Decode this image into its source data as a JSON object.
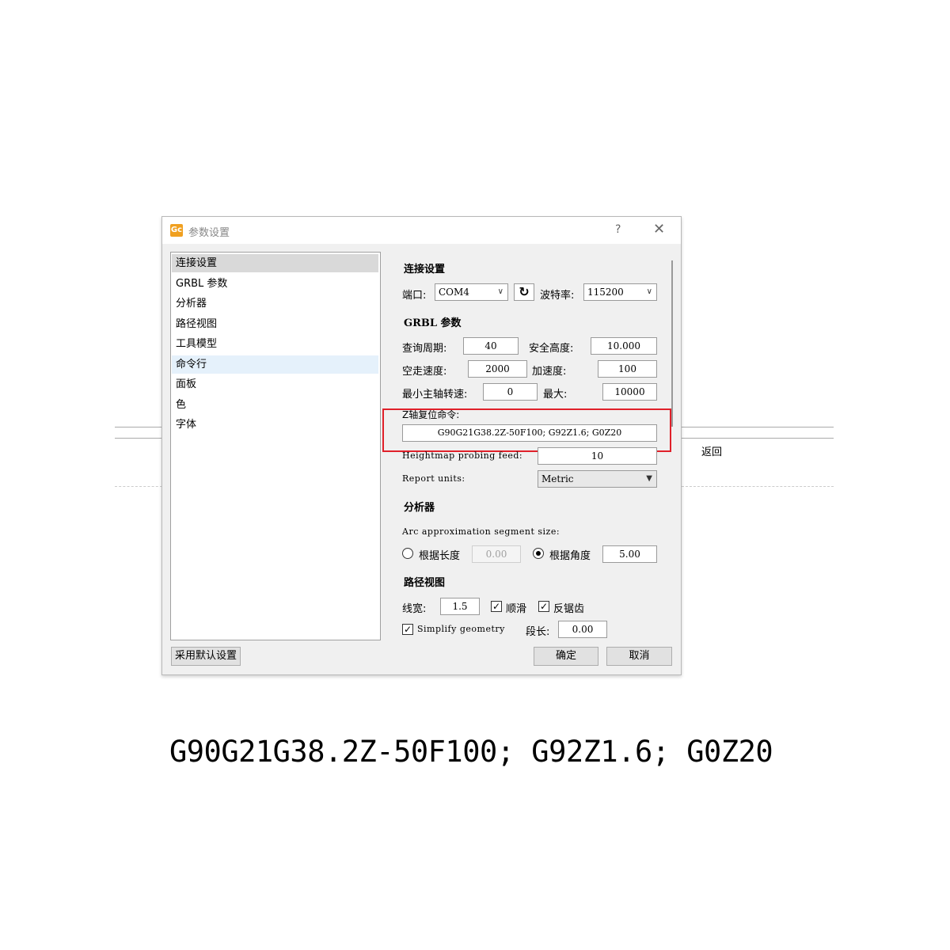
{
  "background": {
    "back_label": "返回"
  },
  "dialog": {
    "title": "参数设置",
    "help_glyph": "?",
    "close_glyph": "✕",
    "icon_letter": "Gc"
  },
  "nav": {
    "items": [
      {
        "label": "连接设置"
      },
      {
        "label": "GRBL 参数"
      },
      {
        "label": "分析器"
      },
      {
        "label": "路径视图"
      },
      {
        "label": "工具模型"
      },
      {
        "label": "命令行"
      },
      {
        "label": "面板"
      },
      {
        "label": "色"
      },
      {
        "label": "字体"
      }
    ],
    "selected_index": 0,
    "hovered_index": 5
  },
  "connection": {
    "section_title": "连接设置",
    "port_label": "端口:",
    "port_value": "COM4",
    "baud_label": "波特率:",
    "baud_value": "115200"
  },
  "grbl": {
    "section_title": "GRBL 参数",
    "query_period_label": "查询周期:",
    "query_period_value": "40",
    "safe_height_label": "安全高度:",
    "safe_height_value": "10.000",
    "rapid_speed_label": "空走速度:",
    "rapid_speed_value": "2000",
    "accel_label": "加速度:",
    "accel_value": "100",
    "min_spindle_label": "最小主轴转速:",
    "min_spindle_value": "0",
    "max_label": "最大:",
    "max_value": "10000",
    "z_reset_label": "Z轴复位命令:",
    "z_reset_value": "G90G21G38.2Z-50F100; G92Z1.6; G0Z20",
    "heightmap_label": "Heightmap probing feed:",
    "heightmap_value": "10",
    "report_units_label": "Report units:",
    "report_units_value": "Metric"
  },
  "analyzer": {
    "section_title": "分析器",
    "arc_label": "Arc approximation segment size:",
    "by_length_label": "根据长度",
    "by_length_value": "0.00",
    "by_angle_label": "根据角度",
    "by_angle_value": "5.00",
    "selected": "by_angle"
  },
  "pathview": {
    "section_title": "路径视图",
    "line_width_label": "线宽:",
    "line_width_value": "1.5",
    "smooth_label": "顺滑",
    "smooth_checked": true,
    "antialias_label": "反锯齿",
    "antialias_checked": true,
    "simplify_label": "Simplify geometry",
    "simplify_checked": true,
    "segment_label": "段长:",
    "segment_value": "0.00"
  },
  "buttons": {
    "defaults": "采用默认设置",
    "ok": "确定",
    "cancel": "取消"
  },
  "caption": {
    "code": "G90G21G38.2Z-50F100; G92Z1.6; G0Z20"
  },
  "colors": {
    "highlight": "#e0202a",
    "selected_row": "#d9d9d9",
    "hover_row": "#e5f1fb"
  }
}
